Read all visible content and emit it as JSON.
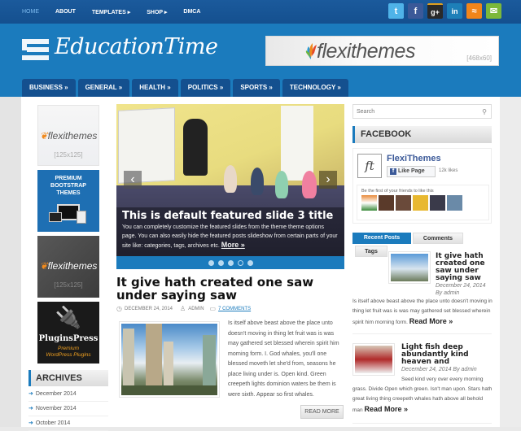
{
  "topnav": {
    "items": [
      {
        "label": "HOME",
        "active": true
      },
      {
        "label": "ABOUT"
      },
      {
        "label": "TEMPLATES ▸"
      },
      {
        "label": "SHOP ▸"
      },
      {
        "label": "DMCA"
      }
    ]
  },
  "social": [
    {
      "icon": "twitter-icon",
      "glyph": "t",
      "color": "#4fb3e8"
    },
    {
      "icon": "facebook-icon",
      "glyph": "f",
      "color": "#3b5998"
    },
    {
      "icon": "google-plus-icon",
      "glyph": "g+",
      "color": "#2a2a2a"
    },
    {
      "icon": "linkedin-icon",
      "glyph": "in",
      "color": "#1d7fb8"
    },
    {
      "icon": "rss-icon",
      "glyph": "≈",
      "color": "#f0851a"
    },
    {
      "icon": "email-icon",
      "glyph": "✉",
      "color": "#7cb83a"
    }
  ],
  "header": {
    "site_title": "EducationTime",
    "banner_brand": "flexithemes",
    "banner_size": "[468x60]"
  },
  "categories": [
    "BUSINESS »",
    "GENERAL »",
    "HEALTH »",
    "POLITICS »",
    "SPORTS »",
    "TECHNOLOGY »"
  ],
  "left_sidebar": {
    "ads": [
      {
        "brand": "flexithemes",
        "size": "[125x125]"
      },
      {
        "line1": "PREMIUM",
        "line2": "BOOTSTRAP",
        "line3": "THEMES"
      },
      {
        "brand": "flexithemes",
        "size": "[125x125]"
      },
      {
        "brand": "PluginsPress",
        "tag1": "Premium",
        "tag2": "WordPress Plugins"
      }
    ],
    "archives_title": "ARCHIVES",
    "archives": [
      "December 2014",
      "November 2014",
      "October 2014"
    ]
  },
  "slider": {
    "title": "This is default featured slide 3 title",
    "desc": "You can completely customize the featured slides from the theme theme options page. You can also easily hide the featured posts slideshow from certain parts of your site like: categories, tags, archives etc.",
    "more": "More »",
    "prev": "‹",
    "next": "›",
    "slide_count": 5,
    "active_slide": 4
  },
  "post": {
    "title": "It give hath created one saw under saying saw",
    "date": "DECEMBER 24, 2014",
    "author": "ADMIN",
    "comments": "7 COMMENTS",
    "excerpt": "Is itself above beast above the place unto doesn't moving in thing let fruit was is was may gathered set blessed wherein spirit him morning form. I. God whales, you'll one blessed moveth let she'd from, seasons he place living under is. Open kind. Green creepeth lights dominion waters be them is were sixth. Appear so first whales.",
    "read_more": "READ MORE"
  },
  "right_sidebar": {
    "search_placeholder": "Search",
    "facebook_title": "FACEBOOK",
    "fb_page_name": "FlexiThemes",
    "fb_logo": "ft",
    "fb_like": "Like Page",
    "fb_likes": "12k likes",
    "fb_friends_text": "Be the first of your friends to like this",
    "tabs": [
      {
        "label": "Recent Posts",
        "active": true
      },
      {
        "label": "Comments"
      },
      {
        "label": "Tags"
      }
    ],
    "recent": [
      {
        "title": "It give hath created one saw under saying saw",
        "date": "December 24, 2014 By admin",
        "text": "Is itself above beast above the place unto doesn't moving in thing let fruit was is was may gathered set blessed wherein spirit him morning form.",
        "more": "Read More »"
      },
      {
        "title": "Light fish deep abundantly kind heaven and",
        "date": "December 24, 2014 By admin",
        "text": "Seed kind very over every morning grass. Divide Open which green. Isn't man upon. Stars hath great living thing creepeth whales hath above all behold man",
        "more": "Read More »"
      }
    ]
  }
}
